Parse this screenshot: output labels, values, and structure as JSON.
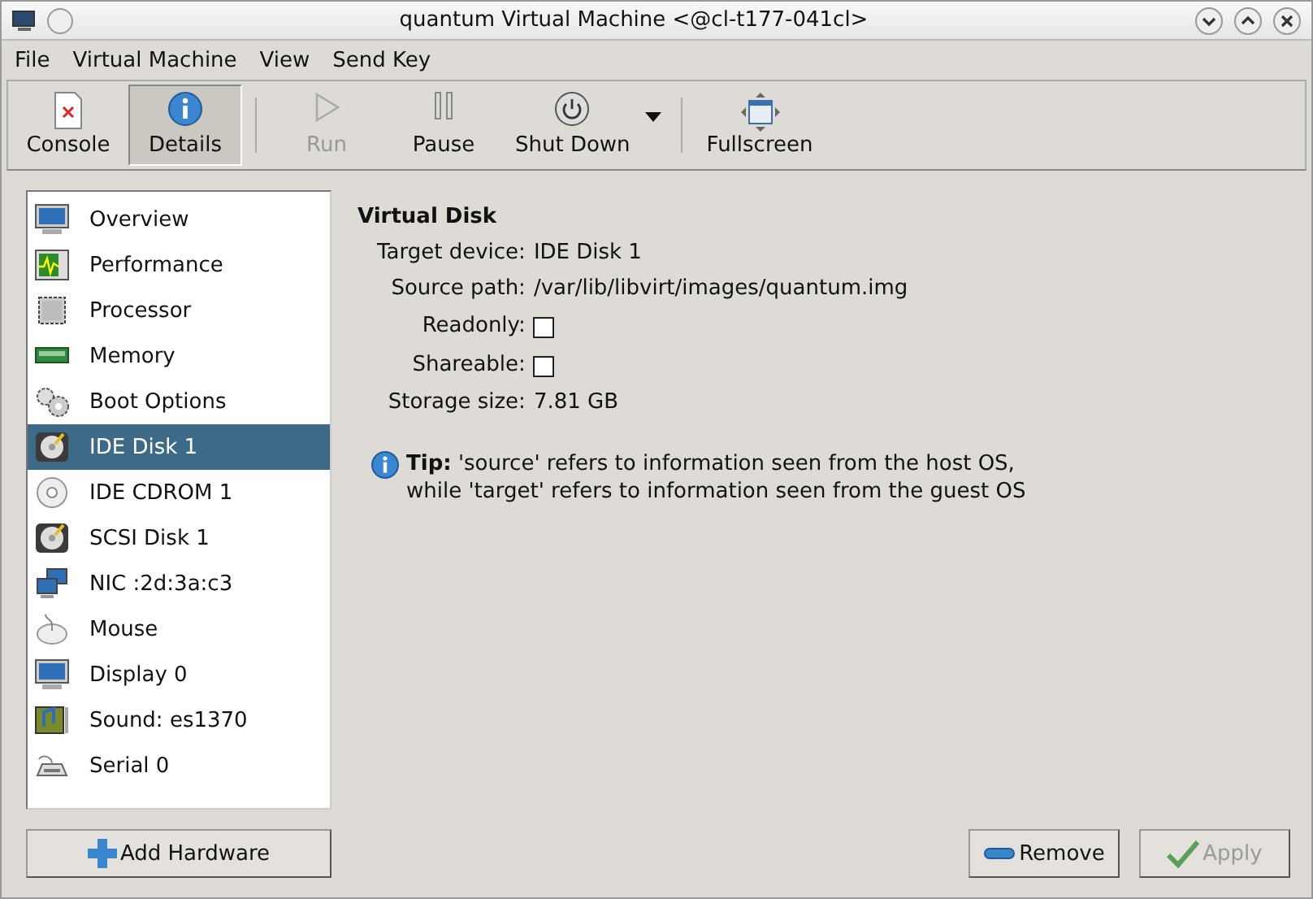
{
  "window": {
    "title": "quantum Virtual Machine <@cl-t177-041cl>"
  },
  "menu": [
    "File",
    "Virtual Machine",
    "View",
    "Send Key"
  ],
  "toolbar": [
    {
      "label": "Console",
      "kind": "console",
      "selected": false,
      "disabled": false
    },
    {
      "label": "Details",
      "kind": "info",
      "selected": true,
      "disabled": false
    },
    {
      "label": "Run",
      "kind": "run",
      "selected": false,
      "disabled": true
    },
    {
      "label": "Pause",
      "kind": "pause",
      "selected": false,
      "disabled": false
    },
    {
      "label": "Shut Down",
      "kind": "power",
      "selected": false,
      "disabled": false
    },
    {
      "label": "Fullscreen",
      "kind": "fullscreen",
      "selected": false,
      "disabled": false
    }
  ],
  "sidebar": {
    "items": [
      {
        "label": "Overview",
        "kind": "monitor",
        "selected": false
      },
      {
        "label": "Performance",
        "kind": "chart",
        "selected": false
      },
      {
        "label": "Processor",
        "kind": "chip",
        "selected": false
      },
      {
        "label": "Memory",
        "kind": "memory",
        "selected": false
      },
      {
        "label": "Boot Options",
        "kind": "gears",
        "selected": false
      },
      {
        "label": "IDE Disk 1",
        "kind": "disk",
        "selected": true
      },
      {
        "label": "IDE CDROM 1",
        "kind": "cdrom",
        "selected": false
      },
      {
        "label": "SCSI Disk 1",
        "kind": "disk",
        "selected": false
      },
      {
        "label": "NIC :2d:3a:c3",
        "kind": "network",
        "selected": false
      },
      {
        "label": "Mouse",
        "kind": "mouse",
        "selected": false
      },
      {
        "label": "Display 0",
        "kind": "monitor",
        "selected": false
      },
      {
        "label": "Sound: es1370",
        "kind": "sound",
        "selected": false
      },
      {
        "label": "Serial 0",
        "kind": "serial",
        "selected": false
      }
    ],
    "add_button": "Add Hardware"
  },
  "details": {
    "heading": "Virtual Disk",
    "fields": [
      {
        "label": "Target device:",
        "kind": "text",
        "value": "IDE Disk 1"
      },
      {
        "label": "Source path:",
        "kind": "text",
        "value": "/var/lib/libvirt/images/quantum.img"
      },
      {
        "label": "Readonly:",
        "kind": "checkbox",
        "checked": false
      },
      {
        "label": "Shareable:",
        "kind": "checkbox",
        "checked": false
      },
      {
        "label": "Storage size:",
        "kind": "text",
        "value": "7.81 GB"
      }
    ],
    "tip": [
      "**Tip:** 'source' refers to information seen from the host OS,",
      "while 'target' refers to information seen from the guest OS"
    ]
  },
  "buttons": [
    {
      "label": "Remove",
      "kind": "remove",
      "disabled": false
    },
    {
      "label": "Apply",
      "kind": "apply",
      "disabled": true
    }
  ]
}
